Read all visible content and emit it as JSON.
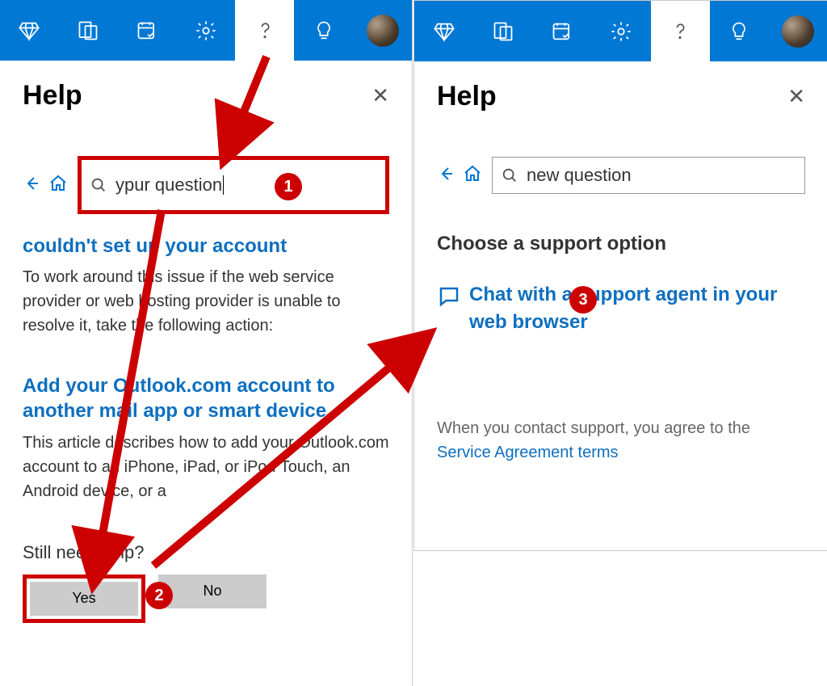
{
  "topbar_icons": [
    "diamond-icon",
    "notes-icon",
    "calendar-check-icon",
    "gear-icon",
    "help-icon",
    "lightbulb-icon",
    "avatar"
  ],
  "left": {
    "title": "Help",
    "search_value": "ypur question",
    "articles": [
      {
        "title": "couldn't set up your account",
        "body": "To work around this issue if the web service provider or web hosting provider is unable to resolve it, take the following action:"
      },
      {
        "title": "Add your Outlook.com account to another mail app or smart device",
        "body": "This article describes how to add your Outlook.com account to an iPhone, iPad, or iPod Touch, an Android device, or a"
      }
    ],
    "still_label": "Still need help?",
    "yes_label": "Yes",
    "no_label": "No"
  },
  "right": {
    "title": "Help",
    "search_value": "new question",
    "section_title": "Choose a support option",
    "chat_link": "Chat with a support agent in your web browser",
    "foot_text": "When you contact support, you agree to the ",
    "foot_link": "Service Agreement terms"
  },
  "annotations": {
    "n1": "1",
    "n2": "2",
    "n3": "3"
  }
}
